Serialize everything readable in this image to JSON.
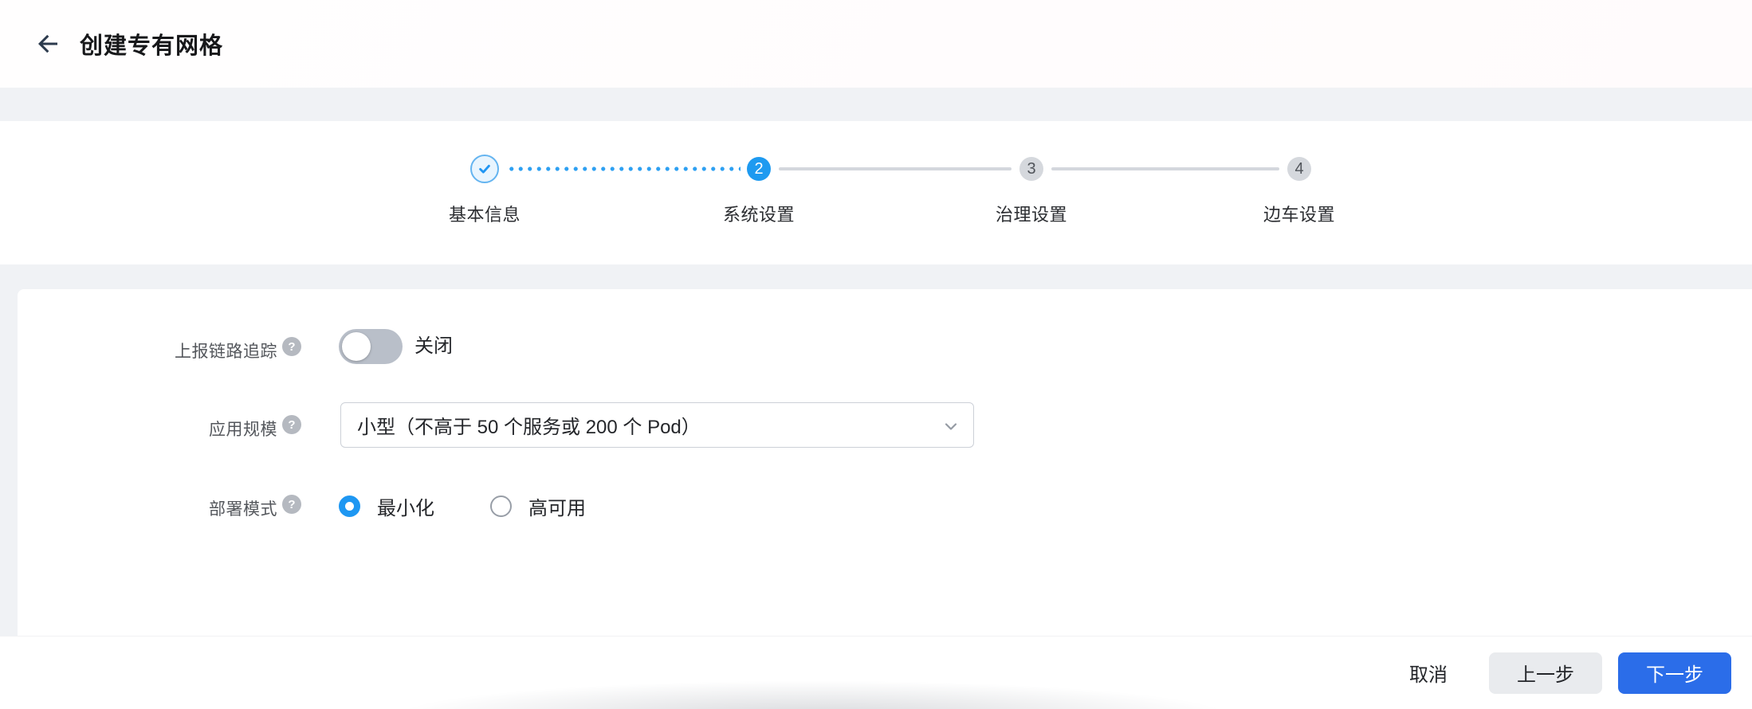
{
  "header": {
    "title": "创建专有网格",
    "back_icon": "arrow-left-icon"
  },
  "stepper": {
    "steps": [
      {
        "label": "基本信息",
        "status": "completed",
        "icon": "check-icon"
      },
      {
        "label": "系统设置",
        "status": "current",
        "number": "2"
      },
      {
        "label": "治理设置",
        "status": "upcoming",
        "number": "3"
      },
      {
        "label": "边车设置",
        "status": "upcoming",
        "number": "4"
      }
    ]
  },
  "form": {
    "tracing": {
      "label": "上报链路追踪",
      "help_icon": "question-mark-icon",
      "help_glyph": "?",
      "toggle_state": "off",
      "state_label": "关闭"
    },
    "scale": {
      "label": "应用规模",
      "help_icon": "question-mark-icon",
      "help_glyph": "?",
      "selected_value": "小型（不高于 50 个服务或 200 个 Pod）",
      "dropdown_icon": "chevron-down-icon"
    },
    "deploy": {
      "label": "部署模式",
      "help_icon": "question-mark-icon",
      "help_glyph": "?",
      "options": [
        {
          "label": "最小化",
          "selected": true
        },
        {
          "label": "高可用",
          "selected": false
        }
      ]
    }
  },
  "footer": {
    "cancel_label": "取消",
    "prev_label": "上一步",
    "next_label": "下一步"
  },
  "colors": {
    "primary_button_blue": "#2b6de9",
    "current_step_blue": "#1e9af0",
    "completed_step_blue": "#2196f3",
    "radio_selected_blue": "#1e97f2",
    "toggle_off_gray": "#b9bfc9",
    "pending_step_gray": "#d5d8dd",
    "page_background": "#f0f2f5"
  }
}
